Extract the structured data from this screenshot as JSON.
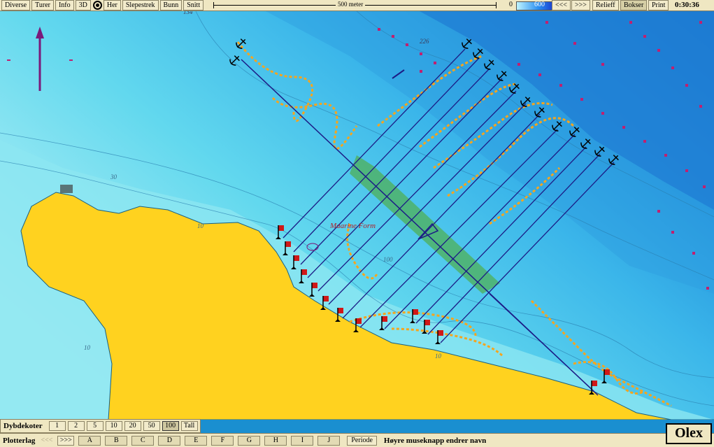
{
  "toolbar": {
    "buttons": [
      "Diverse",
      "Turer",
      "Info",
      "3D",
      "Her",
      "Slepestrek",
      "Bunn",
      "Snitt"
    ],
    "scale_label": "500 meter",
    "depth_min": "0",
    "depth_max": "600",
    "nav_back": "<<<",
    "nav_fwd": ">>>",
    "relieff": "Relieff",
    "bokser": "Bokser",
    "print": "Print",
    "clock": "0:30:36"
  },
  "map": {
    "depth_labels": [
      "134",
      "226",
      "30",
      "10",
      "100",
      "10",
      "10"
    ],
    "area_name": "Maarine Form",
    "colors": {
      "land": "#ffd21f",
      "track": "#f5a51e",
      "line": "#1c1c86",
      "highlight": "#4fb060",
      "flag": "#d01818",
      "mark": "#c02070"
    }
  },
  "dybdekoter": {
    "title": "Dybdekoter",
    "values": [
      "1",
      "2",
      "5",
      "10",
      "20",
      "50",
      "100",
      "Tall"
    ],
    "selected": "100"
  },
  "plotterlag": {
    "title": "Plotterlag",
    "prev": "<<<",
    "next": ">>>",
    "layers": [
      "A",
      "B",
      "C",
      "D",
      "E",
      "F",
      "G",
      "H",
      "I",
      "J"
    ],
    "periode": "Periode",
    "hint": "Høyre museknapp endrer navn"
  },
  "brand": "Olex"
}
